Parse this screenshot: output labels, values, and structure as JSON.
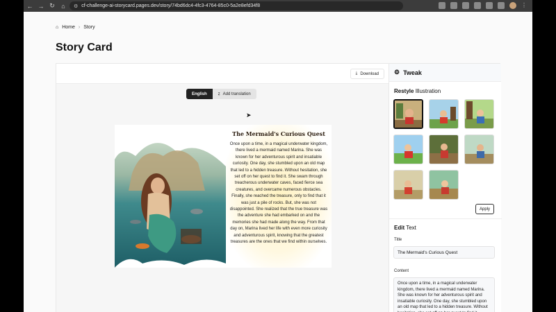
{
  "browser": {
    "url": "cf-challenge-ai-storycard.pages.dev/story/74bd6dc4-4fc3-4764-85c0-5a2e8efd34f8"
  },
  "breadcrumb": {
    "home": "Home",
    "current": "Story"
  },
  "page": {
    "title": "Story Card"
  },
  "toolbar": {
    "download_label": "Download"
  },
  "languages": {
    "active": "English",
    "add_label": "Add translation"
  },
  "story": {
    "title": "The Mermaid's Curious Quest",
    "body": "Once upon a time, in a magical underwater kingdom, there lived a mermaid named Marina. She was known for her adventurous spirit and insatiable curiosity. One day, she stumbled upon an old map that led to a hidden treasure. Without hesitation, she set off on her quest to find it. She swam through treacherous underwater caves, faced fierce sea creatures, and overcame numerous obstacles. Finally, she reached the treasure, only to find that it was just a pile of rocks. But, she was not disappointed. She realized that the true treasure was the adventure she had embarked on and the memories she had made along the way. From that day on, Marina lived her life with even more curiosity and adventurous spirit, knowing that the greatest treasures are the ones that we find within ourselves."
  },
  "tweak": {
    "heading": "Tweak",
    "restyle": {
      "bold": "Restyle",
      "rest": "Illustration"
    },
    "apply_label": "Apply",
    "edit": {
      "bold": "Edit",
      "rest": "Text"
    },
    "title_label": "Title",
    "title_value": "The Mermaid's Curious Quest",
    "content_label": "Content",
    "content_value": "Once upon a time, in a magical underwater kingdom, there lived a mermaid named Marina. She was known for her adventurous spirit and insatiable curiosity. One day, she stumbled upon an old map that led to a hidden treasure. Without hesitation, she set off on her quest to find it."
  },
  "thumbnail_count": 8,
  "colors": {
    "accent": "#111111",
    "panel_bg": "#f7f9fb"
  }
}
